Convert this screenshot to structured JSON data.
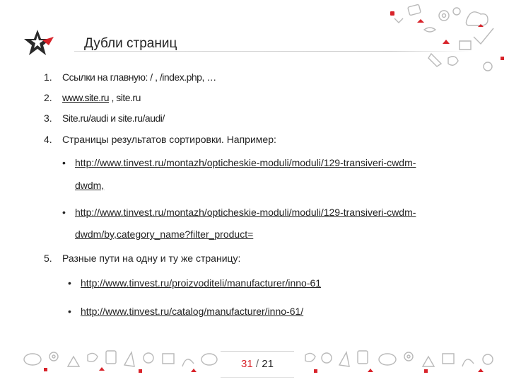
{
  "slide": {
    "title": "Дубли страниц"
  },
  "list": {
    "items": [
      {
        "num": "1.",
        "text": "Ссылки на главную: / , /index.php, …"
      },
      {
        "num": "2.",
        "link": "www.site.ru",
        "rest": " , site.ru"
      },
      {
        "num": "3.",
        "text": "Site.ru/audi и site.ru/audi/"
      },
      {
        "num": "4.",
        "text": "Страницы результатов сортировки. Например:"
      },
      {
        "num": "5.",
        "text": "Разные пути на одну и ту же страницу:"
      }
    ],
    "sub4": [
      {
        "bullet": "•",
        "line1": "http://www.tinvest.ru/montazh/opticheskie-moduli/moduli/129-transiveri-cwdm-",
        "line2": "dwdm,"
      },
      {
        "bullet": "•",
        "line1": "http://www.tinvest.ru/montazh/opticheskie-moduli/moduli/129-transiveri-cwdm-",
        "line2": "dwdm/by,category_name?filter_product="
      }
    ],
    "sub5": [
      {
        "bullet": "•",
        "url": "http://www.tinvest.ru/proizvoditeli/manufacturer/inno-61"
      },
      {
        "bullet": "•",
        "url": "http://www.tinvest.ru/catalog/manufacturer/inno-61/"
      }
    ]
  },
  "pager": {
    "current": "31",
    "separator": " / ",
    "total": "21"
  },
  "colors": {
    "accent": "#d8232a",
    "logo": "#2a2a2a",
    "text": "#222222",
    "deco": "#b9b9b9"
  },
  "icons": [
    "star-logo-icon",
    "doodle-decoration-icon"
  ]
}
